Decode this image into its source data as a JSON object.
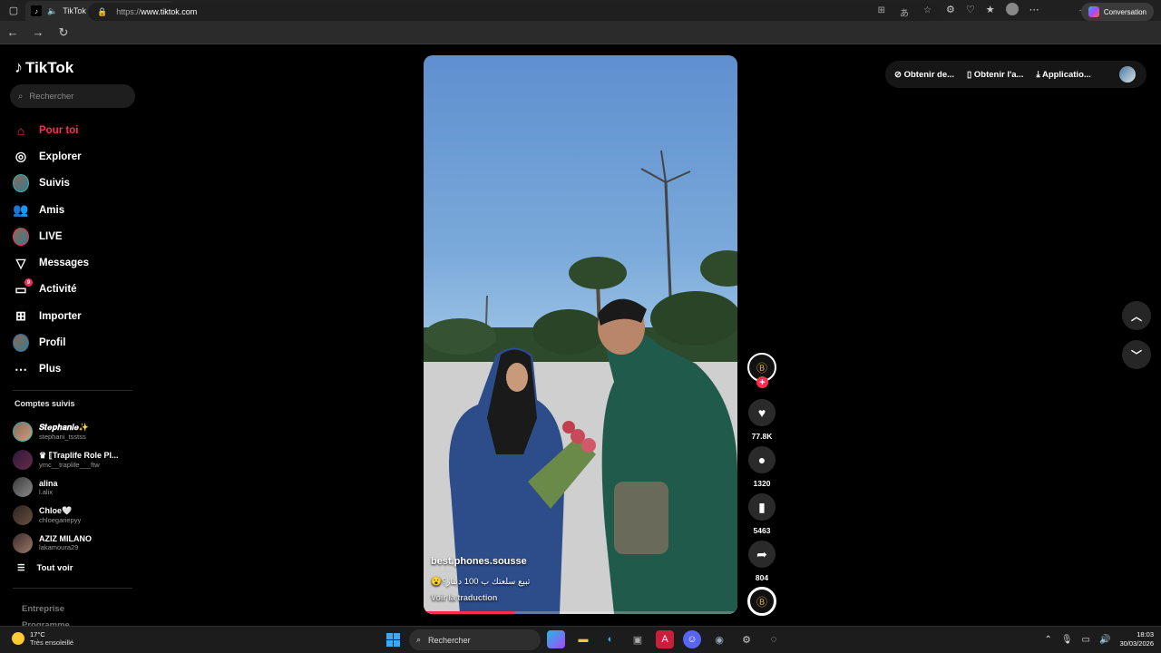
{
  "browser": {
    "tab_title": "TikTok - Make Your Day",
    "url_prefix": "https://",
    "url_host": "www.tiktok.com",
    "copilot_label": "Conversation"
  },
  "sidebar": {
    "logo_text": "TikTok",
    "search_placeholder": "Rechercher",
    "nav": [
      {
        "label": "Pour toi",
        "icon": "home-icon",
        "active": true
      },
      {
        "label": "Explorer",
        "icon": "compass-icon"
      },
      {
        "label": "Suivis",
        "icon": "avatar-icon"
      },
      {
        "label": "Amis",
        "icon": "friends-icon"
      },
      {
        "label": "LIVE",
        "icon": "live-avatar-icon"
      },
      {
        "label": "Messages",
        "icon": "send-icon"
      },
      {
        "label": "Activité",
        "icon": "activity-icon",
        "badge": "9"
      },
      {
        "label": "Importer",
        "icon": "upload-icon"
      },
      {
        "label": "Profil",
        "icon": "profile-icon"
      },
      {
        "label": "Plus",
        "icon": "more-icon"
      }
    ],
    "following_title": "Comptes suivis",
    "accounts": [
      {
        "name": "𝑺𝒕𝒆𝒑𝒉𝒂𝒏𝒊𝒆✨",
        "handle": "stephani_tsstss"
      },
      {
        "name": "♛ ⟦Traplife Role Pl...",
        "handle": "ymc__traplife___ftw"
      },
      {
        "name": "alina",
        "handle": "l.alix"
      },
      {
        "name": "Chloe🤍",
        "handle": "chloegariepyy"
      },
      {
        "name": "AZIZ MILANO",
        "handle": "lakamoura29"
      }
    ],
    "see_all": "Tout voir",
    "footer": [
      "Entreprise",
      "Programme"
    ]
  },
  "video": {
    "username": "best.phones.sousse",
    "description": "تبيع سلعتك ب 100 دينار؟😮",
    "translate": "Voir la traduction",
    "progress": 0.29
  },
  "actions": {
    "likes": "77.8K",
    "comments": "1320",
    "saves": "5463",
    "shares": "804"
  },
  "header": {
    "coins": "Obtenir de...",
    "app": "Obtenir l'a...",
    "download": "Applicatio..."
  },
  "taskbar": {
    "temp": "17°C",
    "weather": "Très ensoleillé",
    "search": "Rechercher",
    "time": "18:03",
    "date": "30/03/2026"
  },
  "colors": {
    "accent": "#fe2c55",
    "background": "#000000"
  }
}
